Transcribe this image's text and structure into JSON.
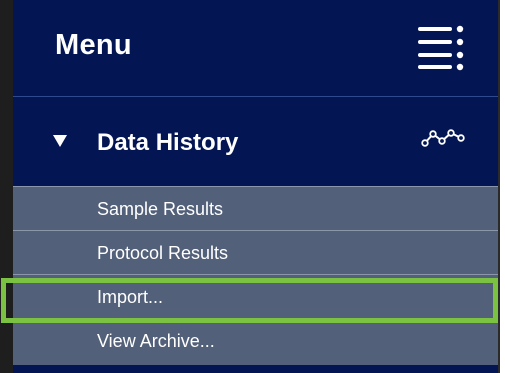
{
  "menu": {
    "title": "Menu",
    "toggle_icon": "hamburger-menu-icon"
  },
  "section": {
    "label": "Data History",
    "expanded": true,
    "expand_icon": "caret-down-icon",
    "icon": "trend-line-icon"
  },
  "items": [
    {
      "label": "Sample Results"
    },
    {
      "label": "Protocol Results"
    },
    {
      "label": "Import...",
      "highlighted": true
    },
    {
      "label": "View Archive..."
    }
  ],
  "colors": {
    "panel_bg": "#041553",
    "item_bg": "#536079",
    "item_divider": "#8b96ab",
    "highlight": "#7cc242",
    "text": "#ffffff"
  }
}
